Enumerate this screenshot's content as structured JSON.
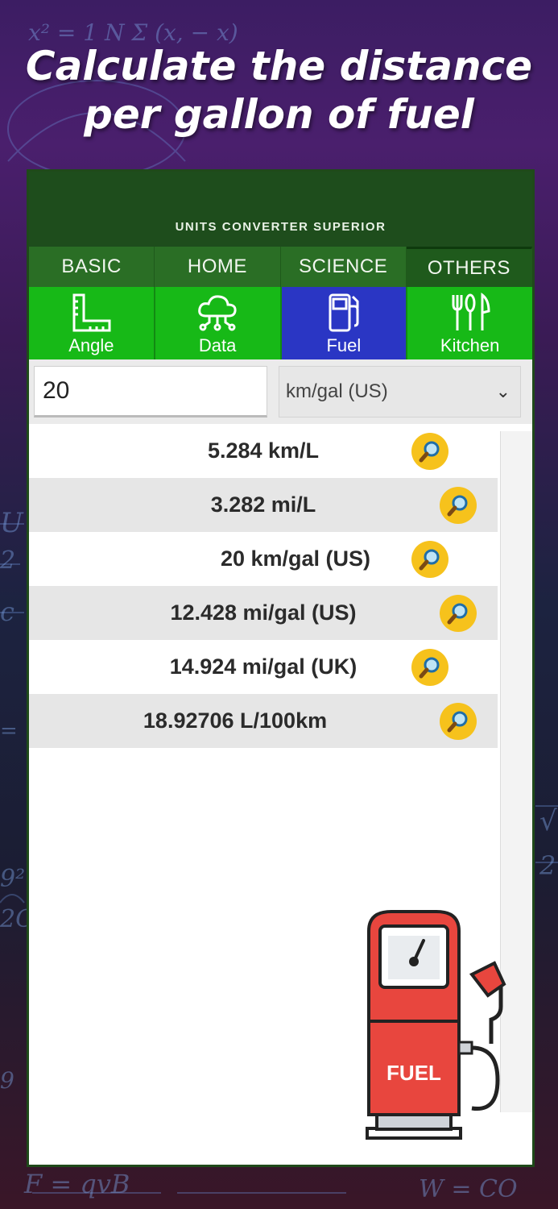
{
  "headline": {
    "line1": "Calculate the distance",
    "line2": "per gallon of fuel"
  },
  "app": {
    "title": "UNITS CONVERTER SUPERIOR"
  },
  "category_tabs": [
    {
      "label": "BASIC",
      "active": false
    },
    {
      "label": "HOME",
      "active": false
    },
    {
      "label": "SCIENCE",
      "active": false
    },
    {
      "label": "OTHERS",
      "active": true
    }
  ],
  "sub_tabs": [
    {
      "label": "Angle",
      "icon": "ruler-angle-icon",
      "active": false
    },
    {
      "label": "Data",
      "icon": "cloud-network-icon",
      "active": false
    },
    {
      "label": "Fuel",
      "icon": "fuel-pump-icon",
      "active": true
    },
    {
      "label": "Kitchen",
      "icon": "utensils-icon",
      "active": false
    }
  ],
  "input": {
    "value": "20",
    "unit": "km/gal (US)"
  },
  "results": [
    {
      "text": "5.284 km/L"
    },
    {
      "text": "3.282 mi/L"
    },
    {
      "text": "20 km/gal (US)"
    },
    {
      "text": "12.428 mi/gal (US)"
    },
    {
      "text": "14.924 mi/gal (UK)"
    },
    {
      "text": "18.92706 L/100km"
    }
  ],
  "illustration": {
    "label": "FUEL"
  },
  "colors": {
    "title_bar": "#1e4d1c",
    "category_bar": "#2a6e25",
    "sub_tab": "#17b917",
    "sub_tab_active": "#2a36c4",
    "magnifier": "#f6c21c",
    "pump_red": "#e8463e"
  }
}
